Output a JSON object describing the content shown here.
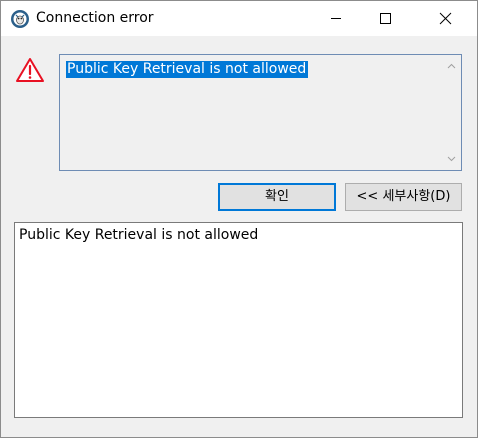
{
  "window": {
    "title": "Connection error",
    "icon": "app-icon"
  },
  "titlebar_controls": {
    "minimize_icon": "minimize-icon",
    "maximize_icon": "maximize-icon",
    "close_icon": "close-icon"
  },
  "message": {
    "icon": "warning-icon",
    "text": "Public Key Retrieval is not allowed",
    "selected": true
  },
  "buttons": {
    "ok_label": "확인",
    "details_label": "<< 세부사항(D)"
  },
  "details": {
    "text": "Public Key Retrieval is not allowed"
  },
  "colors": {
    "selection": "#0078d7",
    "warning": "#e81123",
    "window_bg": "#f0f0f0"
  }
}
